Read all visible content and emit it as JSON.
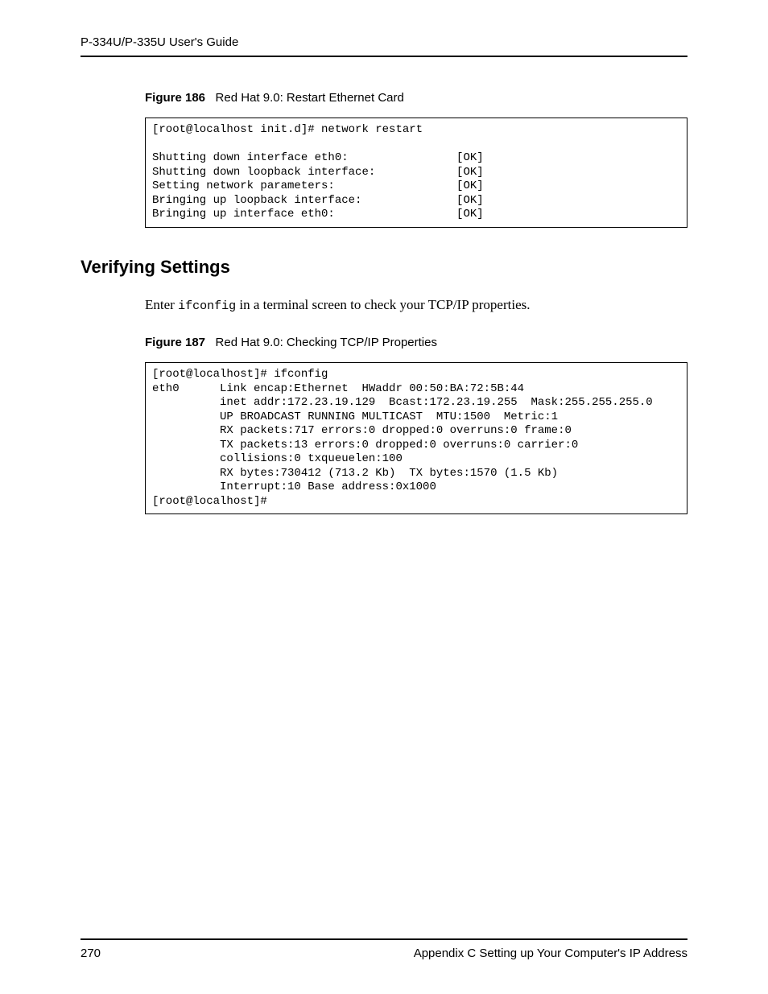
{
  "header": {
    "running_title": "P-334U/P-335U User's Guide"
  },
  "content": {
    "figure186": {
      "label": "Figure 186",
      "title": "Red Hat 9.0: Restart Ethernet Card",
      "code": "[root@localhost init.d]# network restart\n\nShutting down interface eth0:                [OK]\nShutting down loopback interface:            [OK]\nSetting network parameters:                  [OK]\nBringing up loopback interface:              [OK]\nBringing up interface eth0:                  [OK]"
    },
    "section_heading": "Verifying Settings",
    "body_before": "Enter ",
    "body_code": "ifconfig",
    "body_after": " in a terminal screen to check your TCP/IP properties.",
    "figure187": {
      "label": "Figure 187",
      "title": "Red Hat 9.0: Checking TCP/IP Properties",
      "code": "[root@localhost]# ifconfig\neth0      Link encap:Ethernet  HWaddr 00:50:BA:72:5B:44\n          inet addr:172.23.19.129  Bcast:172.23.19.255  Mask:255.255.255.0\n          UP BROADCAST RUNNING MULTICAST  MTU:1500  Metric:1\n          RX packets:717 errors:0 dropped:0 overruns:0 frame:0\n          TX packets:13 errors:0 dropped:0 overruns:0 carrier:0\n          collisions:0 txqueuelen:100\n          RX bytes:730412 (713.2 Kb)  TX bytes:1570 (1.5 Kb)\n          Interrupt:10 Base address:0x1000\n[root@localhost]#"
    }
  },
  "footer": {
    "page_number": "270",
    "section_title": "Appendix C Setting up Your Computer's IP Address"
  }
}
